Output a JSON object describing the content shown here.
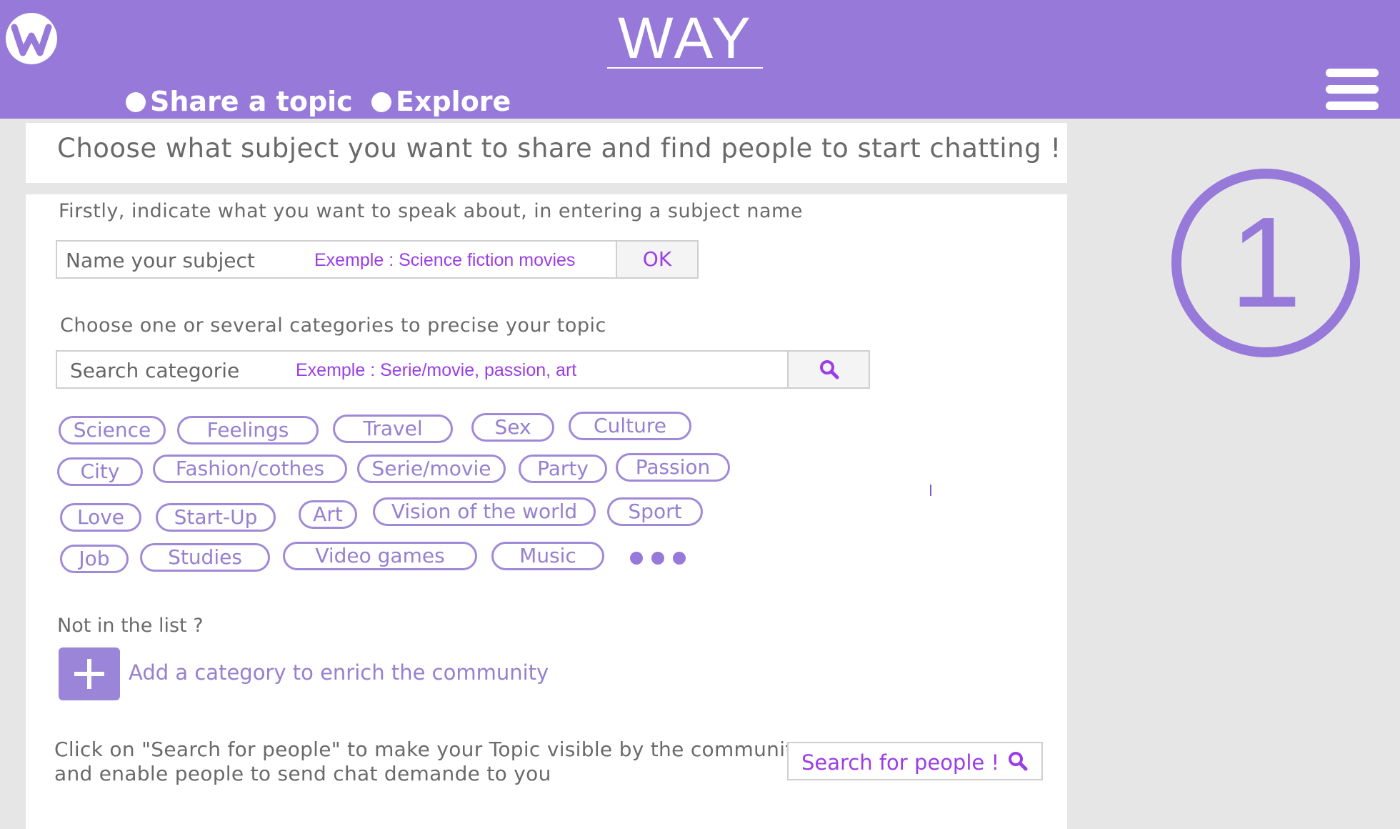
{
  "header": {
    "brand": "WAY",
    "nav": [
      {
        "label": "Share a topic"
      },
      {
        "label": "Explore"
      }
    ],
    "menu_icon": "hamburger-menu-icon",
    "logo_icon": "way-logo-icon"
  },
  "intro": {
    "title": "Choose what subject you want to share and find people to start chatting !"
  },
  "subject": {
    "instruction": "Firstly, indicate what you want to speak about, in entering a subject name",
    "placeholder": "Name your subject",
    "example": "Exemple : Science fiction movies",
    "ok_label": "OK"
  },
  "categories": {
    "instruction": "Choose one or several categories to precise your topic",
    "search_placeholder": "Search categorie",
    "search_example": "Exemple : Serie/movie, passion, art",
    "search_icon": "search-icon",
    "chips": [
      "Science",
      "Feelings",
      "Travel",
      "Sex",
      "Culture",
      "City",
      "Fashion/cothes",
      "Serie/movie",
      "Party",
      "Passion",
      "Love",
      "Start-Up",
      "Art",
      "Vision of the world",
      "Sport",
      "Job",
      "Studies",
      "Video games",
      "Music"
    ],
    "more_icon": "more-dots-icon"
  },
  "add_category": {
    "question": "Not in the list ?",
    "link_label": "Add a category",
    "link_suffix": "to enrich the community"
  },
  "search_people": {
    "line1": "Click on \"Search for people\" to make your Topic visible by the community",
    "line2": "and enable people to send chat demande to you",
    "button_label": "Search for people !"
  },
  "step": {
    "number": "1"
  },
  "colors": {
    "header": "#9779da",
    "accent": "#9b3ee6",
    "chip_border": "#a08ad8",
    "background": "#e6e6e6"
  }
}
